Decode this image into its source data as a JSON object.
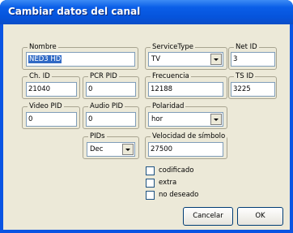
{
  "window": {
    "title": "Cambiar datos del canal"
  },
  "fields": {
    "nombre": {
      "label": "Nombre",
      "value": "NED3 HD"
    },
    "servicetype": {
      "label": "ServiceType",
      "value": "TV"
    },
    "net_id": {
      "label": "Net ID",
      "value": "3"
    },
    "ch_id": {
      "label": "Ch. ID",
      "value": "21040"
    },
    "pcr_pid": {
      "label": "PCR PID",
      "value": "0"
    },
    "frecuencia": {
      "label": "Frecuencia",
      "value": "12188"
    },
    "ts_id": {
      "label": "TS ID",
      "value": "3225"
    },
    "video_pid": {
      "label": "Video PID",
      "value": "0"
    },
    "audio_pid": {
      "label": "Audio PID",
      "value": "0"
    },
    "polaridad": {
      "label": "Polaridad",
      "value": "hor"
    },
    "pids": {
      "label": "PIDs",
      "value": "Dec"
    },
    "velocidad": {
      "label": "Velocidad de símbolo",
      "value": "27500"
    }
  },
  "checkboxes": [
    {
      "label": "codificado",
      "checked": false
    },
    {
      "label": "extra",
      "checked": false
    },
    {
      "label": "no deseado",
      "checked": false
    }
  ],
  "buttons": {
    "cancel": "Cancelar",
    "ok": "OK"
  }
}
